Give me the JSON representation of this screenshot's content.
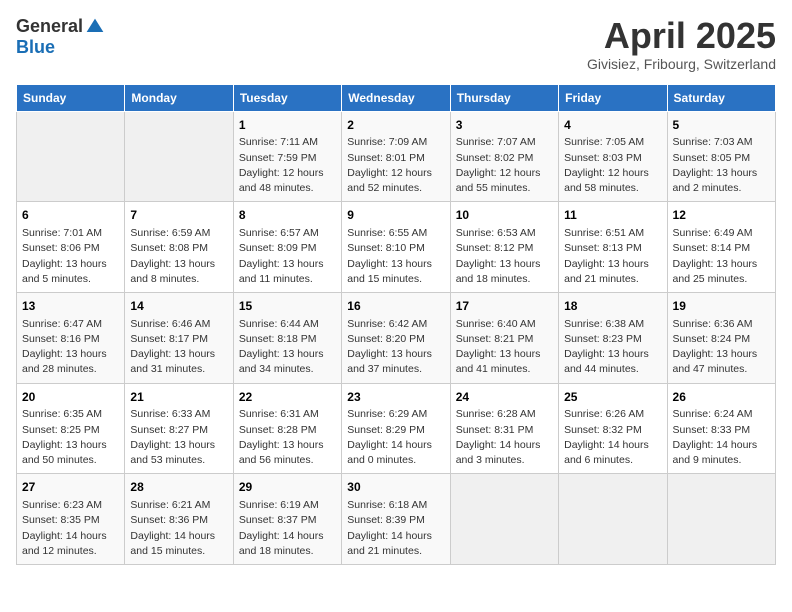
{
  "logo": {
    "general": "General",
    "blue": "Blue"
  },
  "title": "April 2025",
  "subtitle": "Givisiez, Fribourg, Switzerland",
  "weekdays": [
    "Sunday",
    "Monday",
    "Tuesday",
    "Wednesday",
    "Thursday",
    "Friday",
    "Saturday"
  ],
  "weeks": [
    [
      {
        "day": "",
        "info": ""
      },
      {
        "day": "",
        "info": ""
      },
      {
        "day": "1",
        "info": "Sunrise: 7:11 AM\nSunset: 7:59 PM\nDaylight: 12 hours and 48 minutes."
      },
      {
        "day": "2",
        "info": "Sunrise: 7:09 AM\nSunset: 8:01 PM\nDaylight: 12 hours and 52 minutes."
      },
      {
        "day": "3",
        "info": "Sunrise: 7:07 AM\nSunset: 8:02 PM\nDaylight: 12 hours and 55 minutes."
      },
      {
        "day": "4",
        "info": "Sunrise: 7:05 AM\nSunset: 8:03 PM\nDaylight: 12 hours and 58 minutes."
      },
      {
        "day": "5",
        "info": "Sunrise: 7:03 AM\nSunset: 8:05 PM\nDaylight: 13 hours and 2 minutes."
      }
    ],
    [
      {
        "day": "6",
        "info": "Sunrise: 7:01 AM\nSunset: 8:06 PM\nDaylight: 13 hours and 5 minutes."
      },
      {
        "day": "7",
        "info": "Sunrise: 6:59 AM\nSunset: 8:08 PM\nDaylight: 13 hours and 8 minutes."
      },
      {
        "day": "8",
        "info": "Sunrise: 6:57 AM\nSunset: 8:09 PM\nDaylight: 13 hours and 11 minutes."
      },
      {
        "day": "9",
        "info": "Sunrise: 6:55 AM\nSunset: 8:10 PM\nDaylight: 13 hours and 15 minutes."
      },
      {
        "day": "10",
        "info": "Sunrise: 6:53 AM\nSunset: 8:12 PM\nDaylight: 13 hours and 18 minutes."
      },
      {
        "day": "11",
        "info": "Sunrise: 6:51 AM\nSunset: 8:13 PM\nDaylight: 13 hours and 21 minutes."
      },
      {
        "day": "12",
        "info": "Sunrise: 6:49 AM\nSunset: 8:14 PM\nDaylight: 13 hours and 25 minutes."
      }
    ],
    [
      {
        "day": "13",
        "info": "Sunrise: 6:47 AM\nSunset: 8:16 PM\nDaylight: 13 hours and 28 minutes."
      },
      {
        "day": "14",
        "info": "Sunrise: 6:46 AM\nSunset: 8:17 PM\nDaylight: 13 hours and 31 minutes."
      },
      {
        "day": "15",
        "info": "Sunrise: 6:44 AM\nSunset: 8:18 PM\nDaylight: 13 hours and 34 minutes."
      },
      {
        "day": "16",
        "info": "Sunrise: 6:42 AM\nSunset: 8:20 PM\nDaylight: 13 hours and 37 minutes."
      },
      {
        "day": "17",
        "info": "Sunrise: 6:40 AM\nSunset: 8:21 PM\nDaylight: 13 hours and 41 minutes."
      },
      {
        "day": "18",
        "info": "Sunrise: 6:38 AM\nSunset: 8:23 PM\nDaylight: 13 hours and 44 minutes."
      },
      {
        "day": "19",
        "info": "Sunrise: 6:36 AM\nSunset: 8:24 PM\nDaylight: 13 hours and 47 minutes."
      }
    ],
    [
      {
        "day": "20",
        "info": "Sunrise: 6:35 AM\nSunset: 8:25 PM\nDaylight: 13 hours and 50 minutes."
      },
      {
        "day": "21",
        "info": "Sunrise: 6:33 AM\nSunset: 8:27 PM\nDaylight: 13 hours and 53 minutes."
      },
      {
        "day": "22",
        "info": "Sunrise: 6:31 AM\nSunset: 8:28 PM\nDaylight: 13 hours and 56 minutes."
      },
      {
        "day": "23",
        "info": "Sunrise: 6:29 AM\nSunset: 8:29 PM\nDaylight: 14 hours and 0 minutes."
      },
      {
        "day": "24",
        "info": "Sunrise: 6:28 AM\nSunset: 8:31 PM\nDaylight: 14 hours and 3 minutes."
      },
      {
        "day": "25",
        "info": "Sunrise: 6:26 AM\nSunset: 8:32 PM\nDaylight: 14 hours and 6 minutes."
      },
      {
        "day": "26",
        "info": "Sunrise: 6:24 AM\nSunset: 8:33 PM\nDaylight: 14 hours and 9 minutes."
      }
    ],
    [
      {
        "day": "27",
        "info": "Sunrise: 6:23 AM\nSunset: 8:35 PM\nDaylight: 14 hours and 12 minutes."
      },
      {
        "day": "28",
        "info": "Sunrise: 6:21 AM\nSunset: 8:36 PM\nDaylight: 14 hours and 15 minutes."
      },
      {
        "day": "29",
        "info": "Sunrise: 6:19 AM\nSunset: 8:37 PM\nDaylight: 14 hours and 18 minutes."
      },
      {
        "day": "30",
        "info": "Sunrise: 6:18 AM\nSunset: 8:39 PM\nDaylight: 14 hours and 21 minutes."
      },
      {
        "day": "",
        "info": ""
      },
      {
        "day": "",
        "info": ""
      },
      {
        "day": "",
        "info": ""
      }
    ]
  ]
}
